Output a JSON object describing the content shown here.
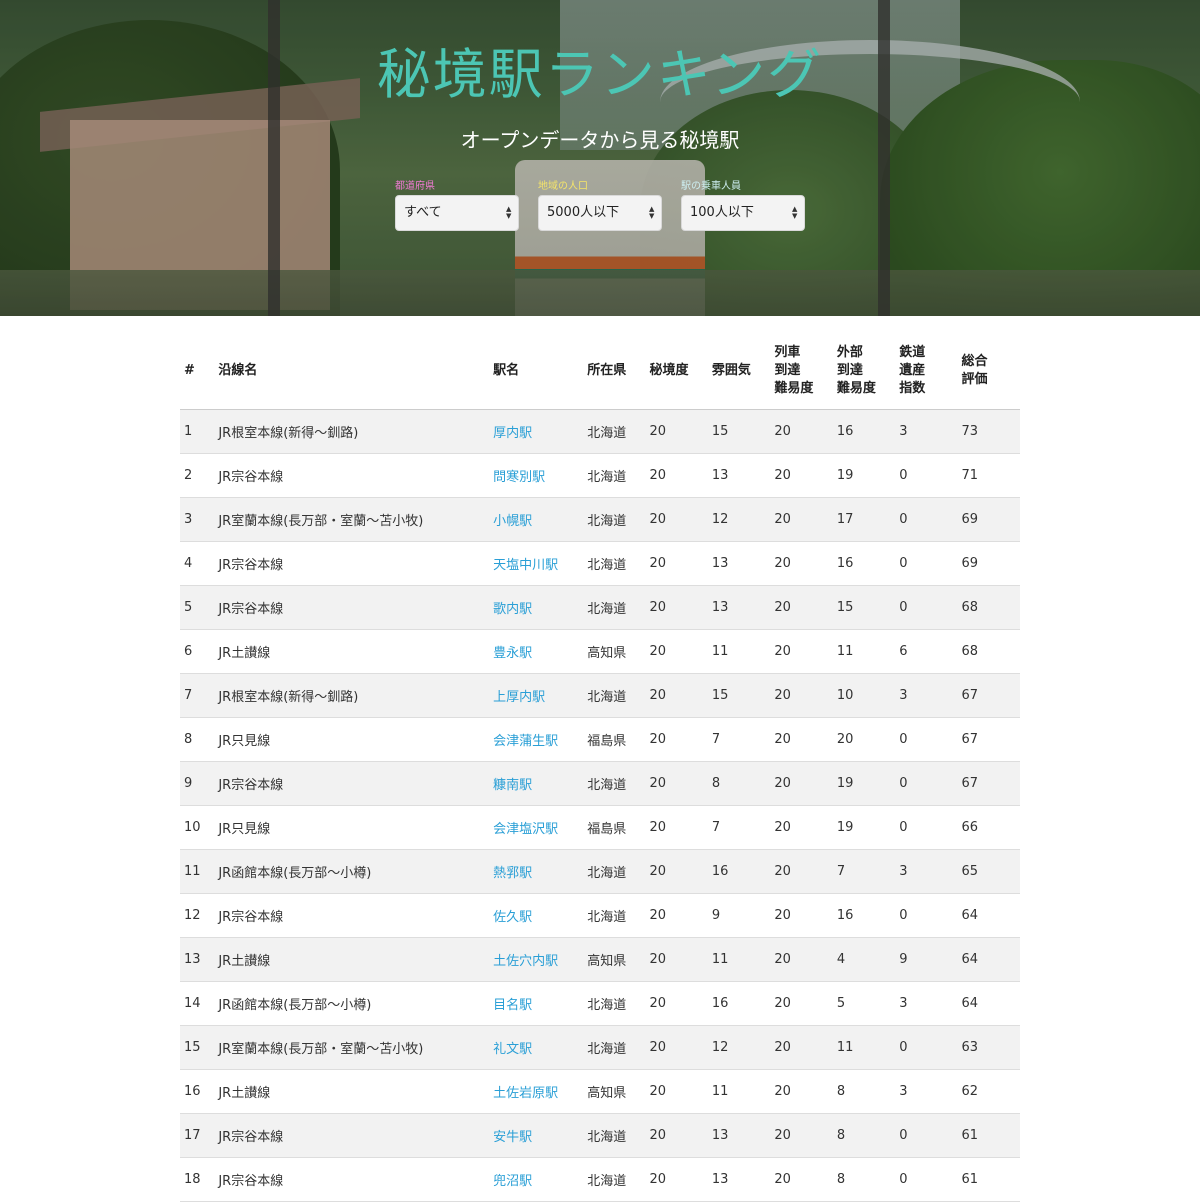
{
  "hero": {
    "title": "秘境駅ランキング",
    "subtitle": "オープンデータから見る秘境駅",
    "filters": [
      {
        "label": "都道府県",
        "value": "すべて",
        "label_color": "#f07ad4"
      },
      {
        "label": "地域の人口",
        "value": "5000人以下",
        "label_color": "#f4e46a"
      },
      {
        "label": "駅の乗車人員",
        "value": "100人以下",
        "label_color": "#cdeef0"
      }
    ]
  },
  "colors": {
    "title": "#4cc6b4",
    "link": "#2a9fd6",
    "row_alt": "#f2f2f2"
  },
  "table": {
    "headers": [
      [
        "#"
      ],
      [
        "沿線名"
      ],
      [
        "駅名"
      ],
      [
        "所在県"
      ],
      [
        "秘境度"
      ],
      [
        "雰囲気"
      ],
      [
        "列車",
        "到達",
        "難易度"
      ],
      [
        "外部",
        "到達",
        "難易度"
      ],
      [
        "鉄道",
        "遺産",
        "指数"
      ],
      [
        "総合",
        "評価"
      ]
    ],
    "rows": [
      [
        "1",
        "JR根室本線(新得〜釧路)",
        "厚内駅",
        "北海道",
        "20",
        "15",
        "20",
        "16",
        "3",
        "73"
      ],
      [
        "2",
        "JR宗谷本線",
        "問寒別駅",
        "北海道",
        "20",
        "13",
        "20",
        "19",
        "0",
        "71"
      ],
      [
        "3",
        "JR室蘭本線(長万部・室蘭〜苫小牧)",
        "小幌駅",
        "北海道",
        "20",
        "12",
        "20",
        "17",
        "0",
        "69"
      ],
      [
        "4",
        "JR宗谷本線",
        "天塩中川駅",
        "北海道",
        "20",
        "13",
        "20",
        "16",
        "0",
        "69"
      ],
      [
        "5",
        "JR宗谷本線",
        "歌内駅",
        "北海道",
        "20",
        "13",
        "20",
        "15",
        "0",
        "68"
      ],
      [
        "6",
        "JR土讃線",
        "豊永駅",
        "高知県",
        "20",
        "11",
        "20",
        "11",
        "6",
        "68"
      ],
      [
        "7",
        "JR根室本線(新得〜釧路)",
        "上厚内駅",
        "北海道",
        "20",
        "15",
        "20",
        "10",
        "3",
        "67"
      ],
      [
        "8",
        "JR只見線",
        "会津蒲生駅",
        "福島県",
        "20",
        "7",
        "20",
        "20",
        "0",
        "67"
      ],
      [
        "9",
        "JR宗谷本線",
        "糠南駅",
        "北海道",
        "20",
        "8",
        "20",
        "19",
        "0",
        "67"
      ],
      [
        "10",
        "JR只見線",
        "会津塩沢駅",
        "福島県",
        "20",
        "7",
        "20",
        "19",
        "0",
        "66"
      ],
      [
        "11",
        "JR函館本線(長万部〜小樽)",
        "熱郛駅",
        "北海道",
        "20",
        "16",
        "20",
        "7",
        "3",
        "65"
      ],
      [
        "12",
        "JR宗谷本線",
        "佐久駅",
        "北海道",
        "20",
        "9",
        "20",
        "16",
        "0",
        "64"
      ],
      [
        "13",
        "JR土讃線",
        "土佐穴内駅",
        "高知県",
        "20",
        "11",
        "20",
        "4",
        "9",
        "64"
      ],
      [
        "14",
        "JR函館本線(長万部〜小樽)",
        "目名駅",
        "北海道",
        "20",
        "16",
        "20",
        "5",
        "3",
        "64"
      ],
      [
        "15",
        "JR室蘭本線(長万部・室蘭〜苫小牧)",
        "礼文駅",
        "北海道",
        "20",
        "12",
        "20",
        "11",
        "0",
        "63"
      ],
      [
        "16",
        "JR土讃線",
        "土佐岩原駅",
        "高知県",
        "20",
        "11",
        "20",
        "8",
        "3",
        "62"
      ],
      [
        "17",
        "JR宗谷本線",
        "安牛駅",
        "北海道",
        "20",
        "13",
        "20",
        "8",
        "0",
        "61"
      ],
      [
        "18",
        "JR宗谷本線",
        "兜沼駅",
        "北海道",
        "20",
        "13",
        "20",
        "8",
        "0",
        "61"
      ]
    ]
  }
}
